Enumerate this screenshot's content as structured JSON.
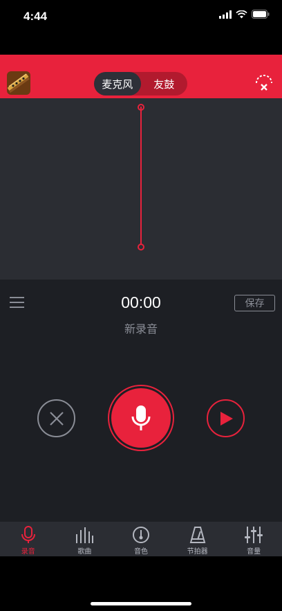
{
  "status_bar": {
    "time": "4:44"
  },
  "header": {
    "segments": [
      {
        "label": "麦克风",
        "active": true
      },
      {
        "label": "友鼓",
        "active": false
      }
    ]
  },
  "recorder": {
    "timer": "00:00",
    "name": "新录音",
    "save_label": "保存"
  },
  "tabs": [
    {
      "label": "录音",
      "icon": "microphone-icon",
      "active": true
    },
    {
      "label": "歌曲",
      "icon": "equalizer-bars-icon",
      "active": false
    },
    {
      "label": "音色",
      "icon": "tone-dial-icon",
      "active": false
    },
    {
      "label": "节拍器",
      "icon": "metronome-icon",
      "active": false
    },
    {
      "label": "音量",
      "icon": "sliders-icon",
      "active": false
    }
  ],
  "colors": {
    "accent": "#e8223c",
    "waveform_bg": "#2b2d33",
    "panel_bg": "#1d1f24",
    "muted_text": "#8a8d96"
  }
}
